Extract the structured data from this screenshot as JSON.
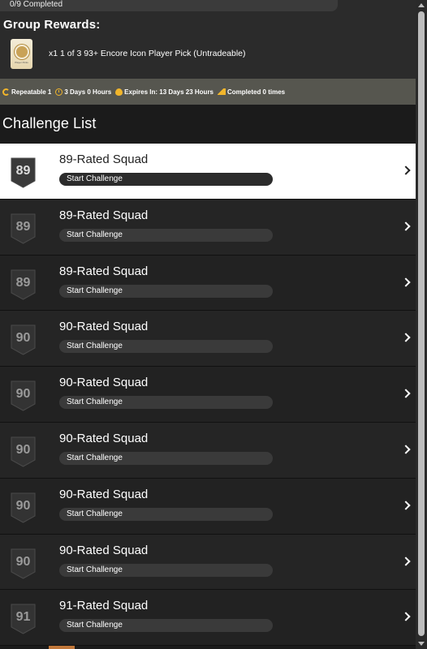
{
  "header": {
    "progress": "0/9 Completed",
    "group_rewards_title": "Group Rewards:",
    "reward_text": "x1 1 of 3 93+ Encore Icon Player Pick (Untradeable)"
  },
  "meta": {
    "repeatable": "Repeatable 1",
    "duration": "3 Days 0 Hours",
    "expires": "Expires In: 13 Days 23 Hours",
    "completed": "Completed 0 times"
  },
  "challenge_list_title": "Challenge List",
  "rows": [
    {
      "rating": "89",
      "title": "89-Rated Squad",
      "button": "Start Challenge"
    },
    {
      "rating": "89",
      "title": "89-Rated Squad",
      "button": "Start Challenge"
    },
    {
      "rating": "89",
      "title": "89-Rated Squad",
      "button": "Start Challenge"
    },
    {
      "rating": "90",
      "title": "90-Rated Squad",
      "button": "Start Challenge"
    },
    {
      "rating": "90",
      "title": "90-Rated Squad",
      "button": "Start Challenge"
    },
    {
      "rating": "90",
      "title": "90-Rated Squad",
      "button": "Start Challenge"
    },
    {
      "rating": "90",
      "title": "90-Rated Squad",
      "button": "Start Challenge"
    },
    {
      "rating": "90",
      "title": "90-Rated Squad",
      "button": "Start Challenge"
    },
    {
      "rating": "91",
      "title": "91-Rated Squad",
      "button": "Start Challenge"
    }
  ],
  "colors": {
    "accent": "#f1b52b",
    "selected_row": "#ffffff",
    "meta_bar": "#56564f"
  }
}
